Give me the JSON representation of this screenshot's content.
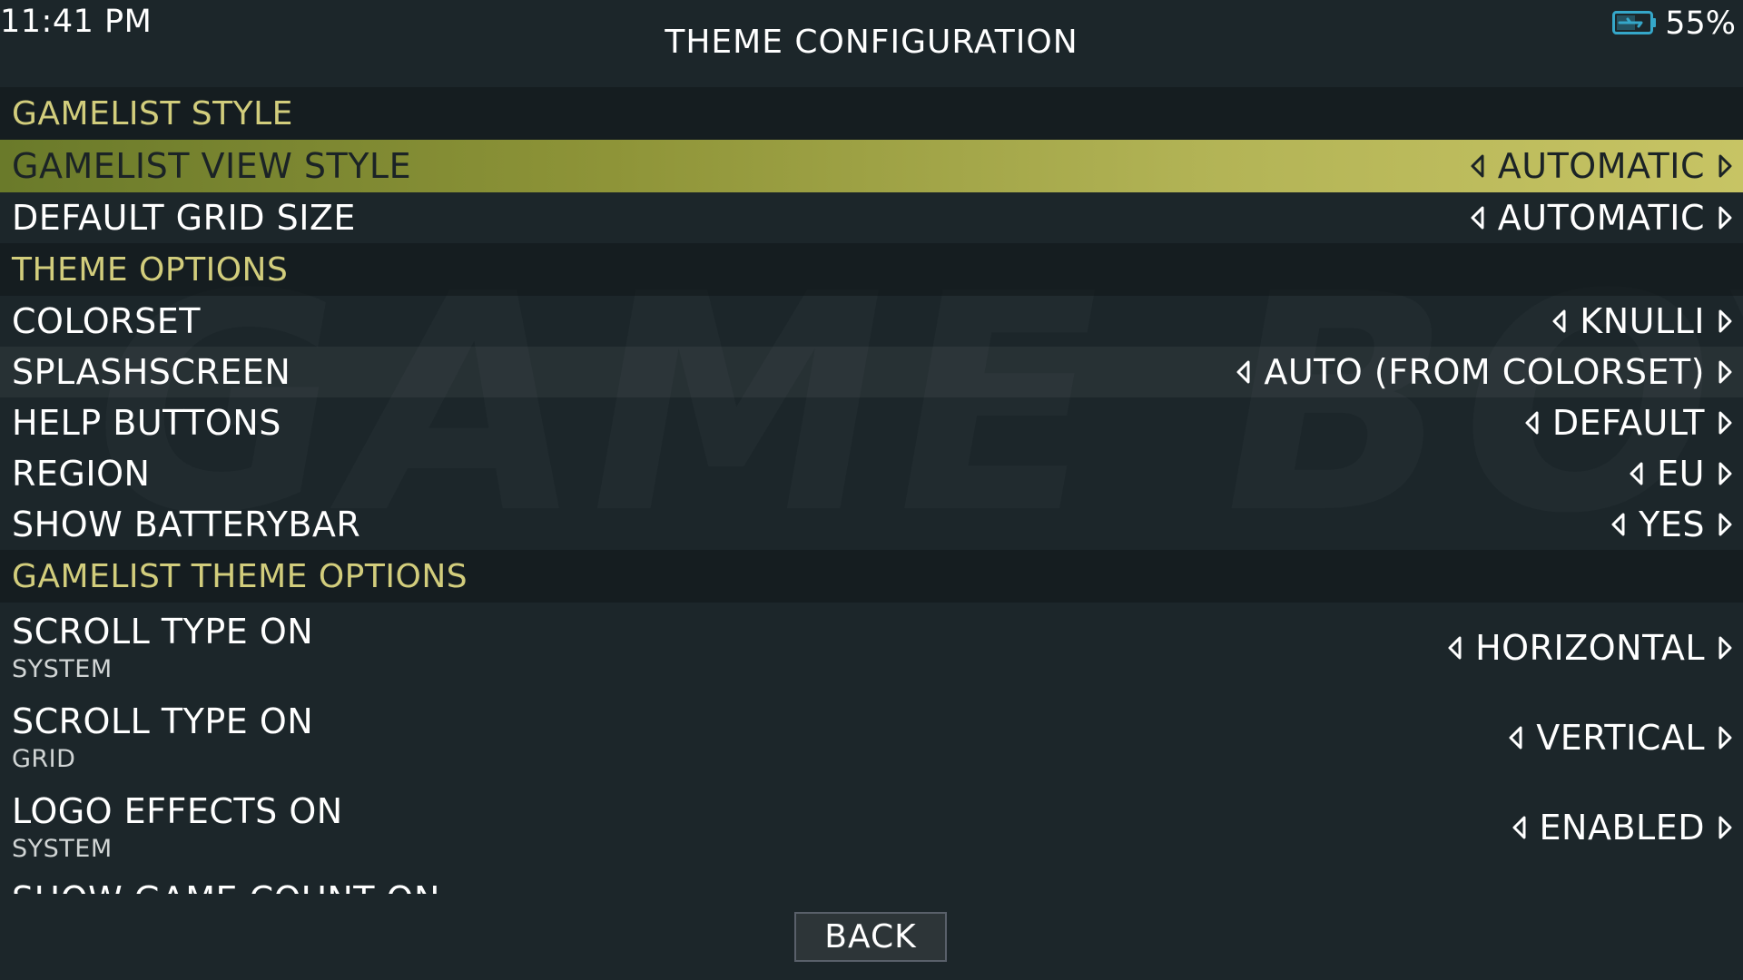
{
  "status": {
    "time": "11:41 PM",
    "battery_percent": "55%",
    "battery_icon": "battery-charging-icon",
    "battery_level": 0.55
  },
  "page_title": "THEME CONFIGURATION",
  "background_watermark": "GAME BOY ADVANCE",
  "colors": {
    "background": "#1c262a",
    "section_header_text": "#d2cd7c",
    "selected_row_start": "#6a7a2a",
    "selected_row_end": "#c7c464",
    "battery_icon": "#35a7c9"
  },
  "menu": {
    "gamelist_style_header": "GAMELIST STYLE",
    "gamelist_view_style": {
      "label": "GAMELIST VIEW STYLE",
      "value": "AUTOMATIC"
    },
    "default_grid_size": {
      "label": "DEFAULT GRID SIZE",
      "value": "AUTOMATIC"
    },
    "theme_options_header": "THEME OPTIONS",
    "colorset": {
      "label": "COLORSET",
      "value": "KNULLI"
    },
    "splashscreen": {
      "label": "SPLASHSCREEN",
      "value": "AUTO (FROM COLORSET)"
    },
    "help_buttons": {
      "label": "HELP BUTTONS",
      "value": "DEFAULT"
    },
    "region": {
      "label": "REGION",
      "value": "EU"
    },
    "show_batterybar": {
      "label": "SHOW BATTERYBAR",
      "value": "YES"
    },
    "gamelist_theme_options_header": "GAMELIST THEME OPTIONS",
    "scroll_type_system": {
      "label": "SCROLL TYPE ON",
      "sublabel": "SYSTEM",
      "value": "HORIZONTAL"
    },
    "scroll_type_grid": {
      "label": "SCROLL TYPE ON",
      "sublabel": "GRID",
      "value": "VERTICAL"
    },
    "logo_effects_system": {
      "label": "LOGO EFFECTS ON",
      "sublabel": "SYSTEM",
      "value": "ENABLED"
    },
    "partial_next_item": "SHOW GAME COUNT ON"
  },
  "back_button": "BACK"
}
